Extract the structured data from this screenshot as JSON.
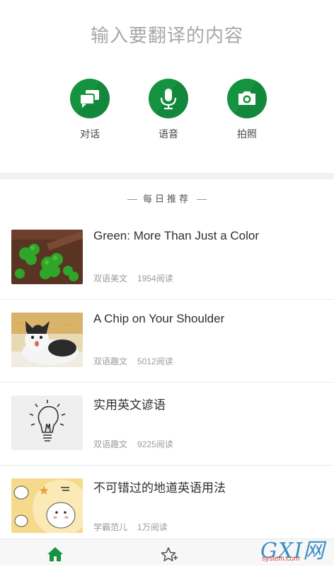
{
  "input": {
    "placeholder": "输入要翻译的内容"
  },
  "actions": [
    {
      "label": "对话",
      "icon": "chat-icon"
    },
    {
      "label": "语音",
      "icon": "microphone-icon"
    },
    {
      "label": "拍照",
      "icon": "camera-icon"
    }
  ],
  "recommend": {
    "title": "每日推荐",
    "articles": [
      {
        "title": "Green: More Than Just a Color",
        "category": "双语美文",
        "reads": "1954阅读",
        "thumb": "clover-image"
      },
      {
        "title": "A Chip on Your Shoulder",
        "category": "双语趣文",
        "reads": "5012阅读",
        "thumb": "cat-image"
      },
      {
        "title": "实用英文谚语",
        "category": "双语趣文",
        "reads": "9225阅读",
        "thumb": "lightbulb-image"
      },
      {
        "title": "不可错过的地道英语用法",
        "category": "学霸范儿",
        "reads": "1万阅读",
        "thumb": "cartoon-image"
      }
    ]
  },
  "tabbar": {
    "items": [
      {
        "icon": "home-icon"
      },
      {
        "icon": "star-add-icon"
      }
    ]
  },
  "watermark": {
    "logo": "GXI网",
    "domain": "system.com"
  },
  "colors": {
    "accent": "#159341",
    "placeholder": "#a7a7a7",
    "meta": "#9a9a9a"
  }
}
